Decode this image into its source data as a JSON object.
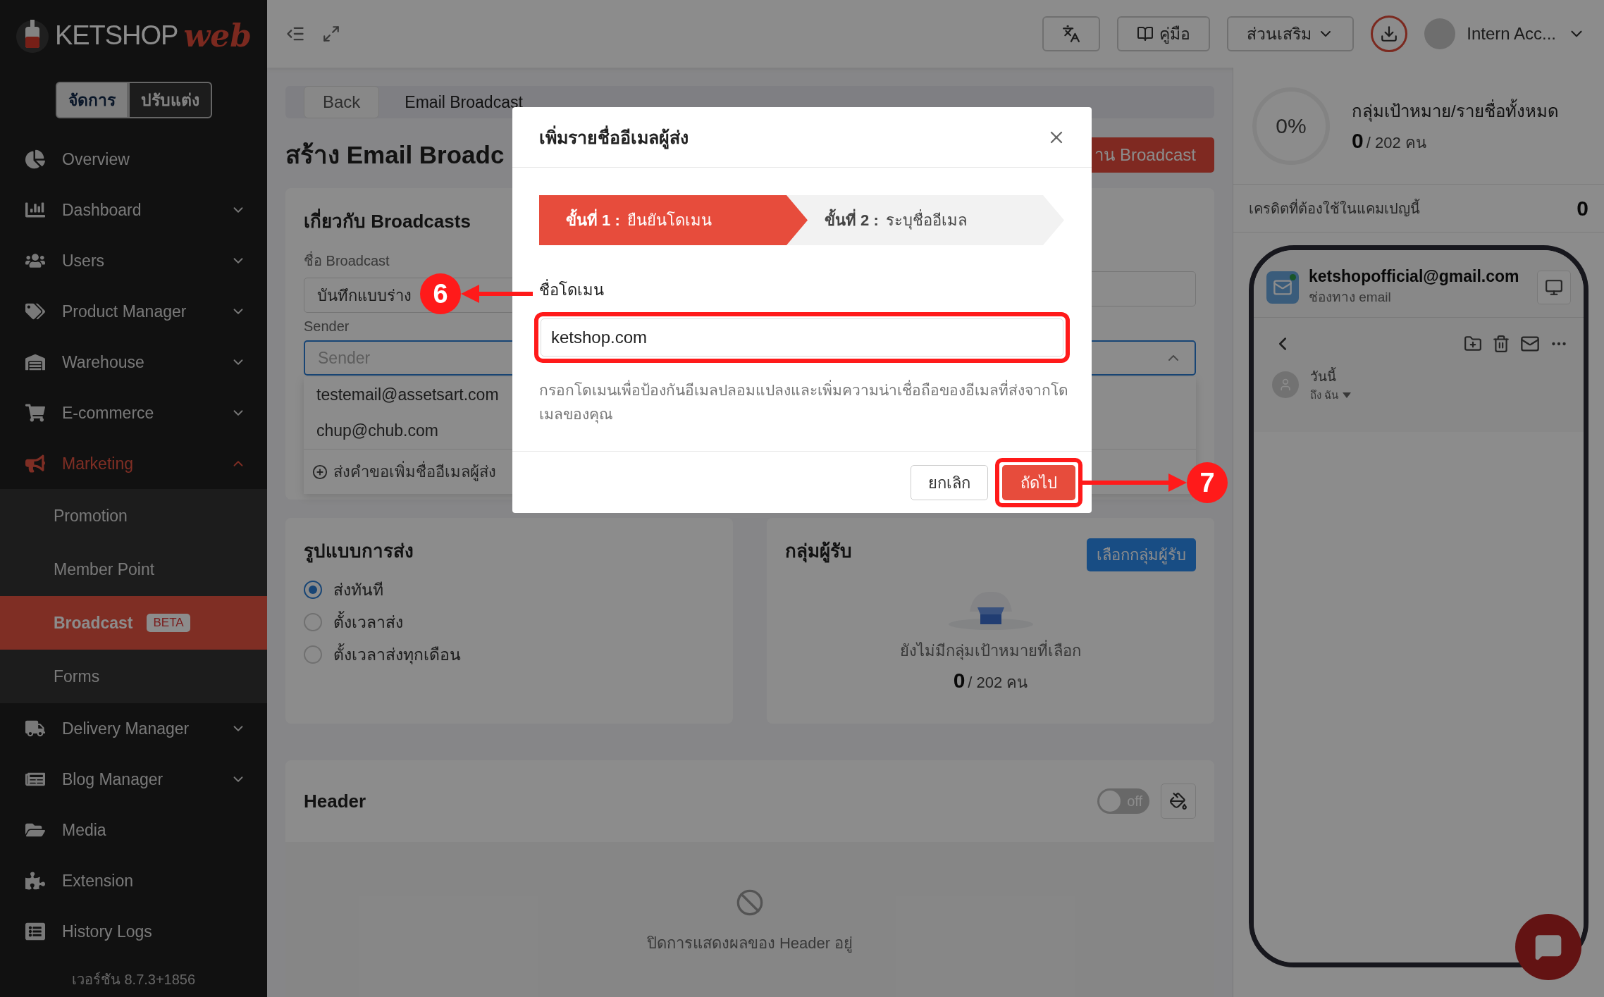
{
  "sidebar": {
    "logo": {
      "name": "KETSHOP",
      "accent": "web"
    },
    "mode_switch": [
      {
        "label": "จัดการ",
        "selected": true
      },
      {
        "label": "ปรับแต่ง",
        "selected": false
      }
    ],
    "items": [
      {
        "label": "Overview",
        "selected": false
      },
      {
        "label": "Dashboard",
        "selected": false,
        "expanded": false
      },
      {
        "label": "Users",
        "selected": false,
        "expanded": false
      },
      {
        "label": "Product Manager",
        "selected": false,
        "expanded": false
      },
      {
        "label": "Warehouse",
        "selected": false,
        "expanded": false
      },
      {
        "label": "E-commerce",
        "selected": false,
        "expanded": false
      },
      {
        "label": "Marketing",
        "selected": true,
        "expanded": true,
        "children": [
          {
            "label": "Promotion",
            "selected": false
          },
          {
            "label": "Member Point",
            "selected": false
          },
          {
            "label": "Broadcast",
            "selected": true,
            "badge": "BETA"
          },
          {
            "label": "Forms",
            "selected": false
          }
        ]
      },
      {
        "label": "Delivery Manager",
        "selected": false,
        "expanded": false
      },
      {
        "label": "Blog Manager",
        "selected": false,
        "expanded": false
      },
      {
        "label": "Media",
        "selected": false
      },
      {
        "label": "Extension",
        "selected": false
      },
      {
        "label": "History Logs",
        "selected": false
      }
    ],
    "version": "เวอร์ชัน 8.7.3+1856"
  },
  "topbar": {
    "guide": "คู่มือ",
    "addons": "ส่วนเสริม",
    "user": "Intern Acc..."
  },
  "page": {
    "back": "Back",
    "breadcrumb": "Email Broadcast",
    "title": "สร้าง Email Broadc",
    "action": "าน Broadcast",
    "about": {
      "title": "เกี่ยวกับ Broadcasts",
      "name_label": "ชื่อ Broadcast",
      "name_value": "บันทึกแบบร่าง",
      "sender_label": "Sender",
      "sender_placeholder": "Sender",
      "sender_options": [
        "testemail@assetsart.com",
        "chup@chub.com"
      ],
      "request_link": "ส่งคำขอเพิ่มชื่ออีเมลผู้ส่ง"
    },
    "send_type": {
      "title": "รูปแบบการส่ง",
      "options": [
        {
          "label": "ส่งทันที",
          "selected": true
        },
        {
          "label": "ตั้งเวลาส่ง",
          "selected": false
        },
        {
          "label": "ตั้งเวลาส่งทุกเดือน",
          "selected": false
        }
      ]
    },
    "recipients": {
      "title": "กลุ่มผู้รับ",
      "button": "เลือกกลุ่มผู้รับ",
      "empty_text": "ยังไม่มีกลุ่มเป้าหมายที่เลือก",
      "count": "0",
      "total": "/ 202 คน"
    },
    "header": {
      "title": "Header",
      "toggle": {
        "on": false,
        "label": "off"
      },
      "empty_text": "ปิดการแสดงผลของ Header อยู่"
    }
  },
  "summary": {
    "level": 0,
    "percent": "0%",
    "title": "กลุ่มเป้าหมาย/รายชื่อทั้งหมด",
    "count": "0",
    "total": "/ 202 คน",
    "credit_label": "เครดิตที่ต้องใช้ในแคมเปญนี้",
    "credit_value": "0"
  },
  "preview": {
    "sender": "ketshopofficial@gmail.com",
    "channel": "ช่องทาง email",
    "date": "วันนี้",
    "to": "ถึง ฉัน"
  },
  "modal": {
    "title": "เพิ่มรายชื่ออีเมลผู้ส่ง",
    "steps": [
      {
        "number": "ขั้นที่ 1 :",
        "label": "ยืนยันโดเมน",
        "selected": true
      },
      {
        "number": "ขั้นที่ 2 :",
        "label": "ระบุชื่ออีเมล",
        "selected": false
      }
    ],
    "field_label": "ชื่อโดเมน",
    "field_value": "ketshop.com",
    "help": "กรอกโดเมนเพื่อป้องกันอีเมลปลอมแปลงและเพิ่มความน่าเชื่อถือของอีเมลที่ส่งจากโดเมลของคุณ",
    "cancel": "ยกเลิก",
    "next": "ถัดไป"
  },
  "callouts": [
    "6",
    "7"
  ]
}
